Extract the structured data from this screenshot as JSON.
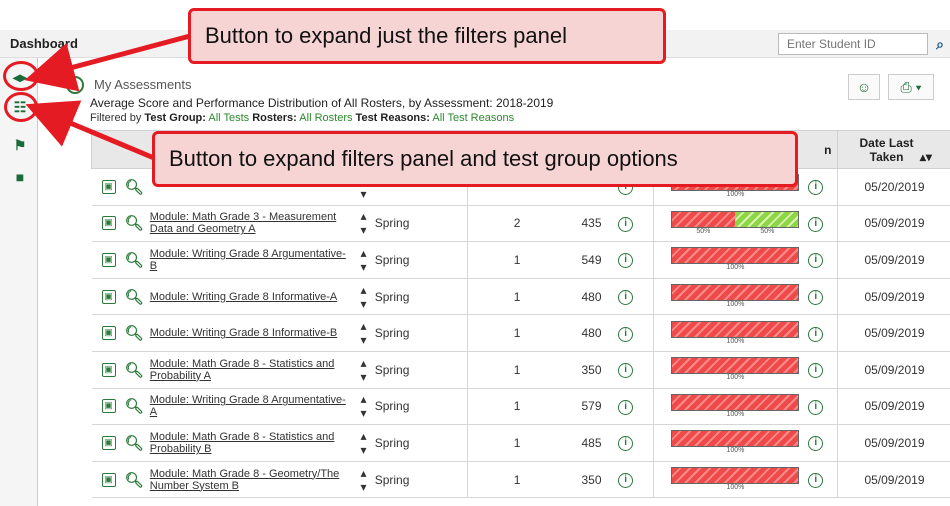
{
  "header": {
    "title": "Dashboard",
    "student_id_placeholder": "Enter Student ID"
  },
  "section": {
    "label": "My Assessments",
    "subtitle": "Average Score and Performance Distribution of All Rosters, by Assessment: 2018-2019",
    "filters_prefix": "Filtered by",
    "filters": [
      {
        "label": "Test Group:",
        "value": "All Tests"
      },
      {
        "label": "Rosters:",
        "value": "All Rosters"
      },
      {
        "label": "Test Reasons:",
        "value": "All Test Reasons"
      }
    ]
  },
  "table": {
    "header_distribution_partial": "n",
    "header_date": "Date Last Taken",
    "rows": [
      {
        "name": "",
        "admin": "",
        "students": "",
        "score": "",
        "date": "05/20/2019",
        "dist": [
          {
            "pct": 100,
            "color": "red"
          }
        ],
        "labels": [
          "100%"
        ]
      },
      {
        "name": "Module: Math Grade 3 - Measurement Data and Geometry A",
        "admin": "Spring",
        "students": "2",
        "score": "435",
        "date": "05/09/2019",
        "dist": [
          {
            "pct": 50,
            "color": "red"
          },
          {
            "pct": 50,
            "color": "green"
          }
        ],
        "labels": [
          "50%",
          "50%"
        ]
      },
      {
        "name": "Module: Writing Grade 8 Argumentative-B",
        "admin": "Spring",
        "students": "1",
        "score": "549",
        "date": "05/09/2019",
        "dist": [
          {
            "pct": 100,
            "color": "red"
          }
        ],
        "labels": [
          "100%"
        ]
      },
      {
        "name": "Module: Writing Grade 8 Informative-A",
        "admin": "Spring",
        "students": "1",
        "score": "480",
        "date": "05/09/2019",
        "dist": [
          {
            "pct": 100,
            "color": "red"
          }
        ],
        "labels": [
          "100%"
        ]
      },
      {
        "name": "Module: Writing Grade 8 Informative-B",
        "admin": "Spring",
        "students": "1",
        "score": "480",
        "date": "05/09/2019",
        "dist": [
          {
            "pct": 100,
            "color": "red"
          }
        ],
        "labels": [
          "100%"
        ]
      },
      {
        "name": "Module: Math Grade 8 - Statistics and Probability A",
        "admin": "Spring",
        "students": "1",
        "score": "350",
        "date": "05/09/2019",
        "dist": [
          {
            "pct": 100,
            "color": "red"
          }
        ],
        "labels": [
          "100%"
        ]
      },
      {
        "name": "Module: Writing Grade 8 Argumentative-A",
        "admin": "Spring",
        "students": "1",
        "score": "579",
        "date": "05/09/2019",
        "dist": [
          {
            "pct": 100,
            "color": "red"
          }
        ],
        "labels": [
          "100%"
        ]
      },
      {
        "name": "Module: Math Grade 8 - Statistics and Probability B",
        "admin": "Spring",
        "students": "1",
        "score": "485",
        "date": "05/09/2019",
        "dist": [
          {
            "pct": 100,
            "color": "red"
          }
        ],
        "labels": [
          "100%"
        ]
      },
      {
        "name": "Module: Math Grade 8 - Geometry/The Number System B",
        "admin": "Spring",
        "students": "1",
        "score": "350",
        "date": "05/09/2019",
        "dist": [
          {
            "pct": 100,
            "color": "red"
          }
        ],
        "labels": [
          "100%"
        ]
      }
    ]
  },
  "callouts": {
    "top": "Button to expand just the filters panel",
    "middle": "Button to expand filters panel and test group options"
  },
  "colors": {
    "accent_green": "#2a7a3a",
    "callout_border": "#e51b23",
    "callout_fill": "#f7d4d4",
    "bar_red": "#ee4a4a",
    "bar_green": "#8ed645"
  }
}
